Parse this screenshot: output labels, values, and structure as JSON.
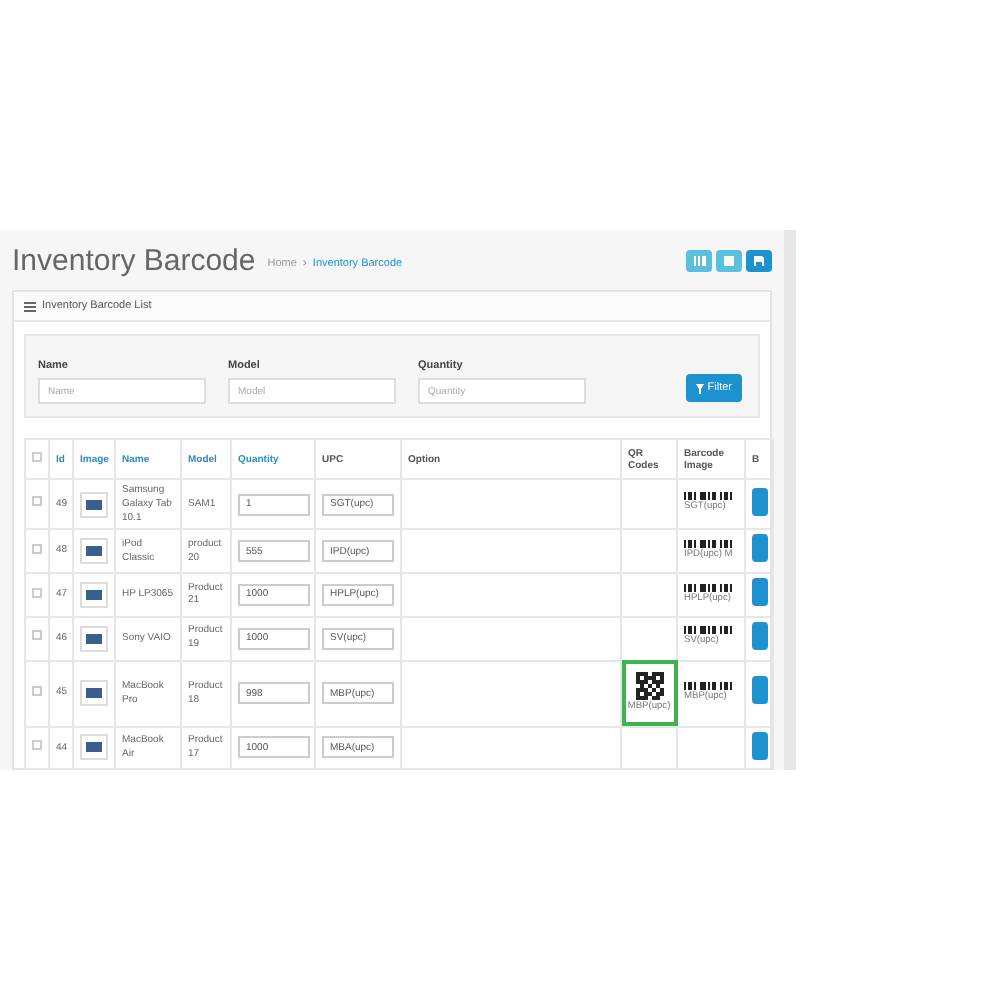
{
  "header": {
    "title": "Inventory Barcode",
    "breadcrumb": [
      "Home",
      "Inventory Barcode"
    ],
    "breadcrumb_separator": "›",
    "buttons": [
      {
        "kind": "barcode"
      },
      {
        "kind": "print"
      },
      {
        "kind": "save"
      }
    ]
  },
  "panel": {
    "title": "Inventory Barcode List"
  },
  "filter": {
    "fields": [
      {
        "label": "Name",
        "placeholder": "Name"
      },
      {
        "label": "Model",
        "placeholder": "Model"
      },
      {
        "label": "Quantity",
        "placeholder": "Quantity"
      }
    ],
    "button": "Filter"
  },
  "table": {
    "select_all": {
      "checked": false
    },
    "columns": [
      {
        "label": "Id",
        "sortable": true
      },
      {
        "label": "Image",
        "sortable": true
      },
      {
        "label": "Name",
        "sortable": true
      },
      {
        "label": "Model",
        "sortable": true
      },
      {
        "label": "Quantity",
        "sortable": true
      },
      {
        "label": "UPC",
        "sortable": false
      },
      {
        "label": "Option",
        "sortable": false
      },
      {
        "label": "QR Codes",
        "sortable": false
      },
      {
        "label": "Barcode Image",
        "sortable": false
      },
      {
        "label": "B",
        "sortable": false
      }
    ],
    "rows": [
      {
        "checked": false,
        "id": "49",
        "name": "Samsung Galaxy Tab 10.1",
        "model": "SAM1",
        "quantity": "1",
        "upc": "SGT(upc)",
        "qr": null,
        "qr_highlighted": false,
        "barcode": "SGT(upc)"
      },
      {
        "checked": false,
        "id": "48",
        "name": "iPod Classic",
        "model": "product 20",
        "quantity": "555",
        "upc": "IPD(upc)",
        "qr": null,
        "qr_highlighted": false,
        "barcode": "IPD(upc) M"
      },
      {
        "checked": false,
        "id": "47",
        "name": "HP LP3065",
        "model": "Product 21",
        "quantity": "1000",
        "upc": "HPLP(upc)",
        "qr": null,
        "qr_highlighted": false,
        "barcode": "HPLP(upc)"
      },
      {
        "checked": false,
        "id": "46",
        "name": "Sony VAIO",
        "model": "Product 19",
        "quantity": "1000",
        "upc": "SV(upc)",
        "qr": null,
        "qr_highlighted": false,
        "barcode": "SV(upc)"
      },
      {
        "checked": false,
        "id": "45",
        "name": "MacBook Pro",
        "model": "Product 18",
        "quantity": "998",
        "upc": "MBP(upc)",
        "qr": "MBP(upc)",
        "qr_highlighted": true,
        "barcode": "MBP(upc)"
      },
      {
        "checked": false,
        "id": "44",
        "name": "MacBook Air",
        "model": "Product 17",
        "quantity": "1000",
        "upc": "MBA(upc)",
        "qr": null,
        "qr_highlighted": false,
        "barcode": null
      }
    ]
  }
}
